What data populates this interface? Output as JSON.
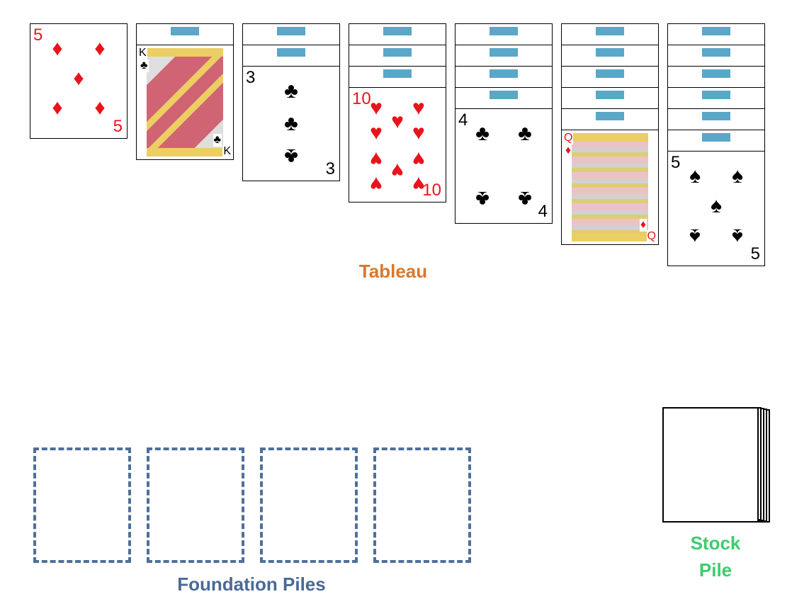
{
  "labels": {
    "tableau": "Tableau",
    "foundation": "Foundation Piles",
    "stock_line1": "Stock",
    "stock_line2": "Pile"
  },
  "colors": {
    "tableau_label": "#d9782d",
    "foundation_label": "#4a6a94",
    "stock_label": "#3dcc6e",
    "red_suit": "#e8141c",
    "foundation_border": "#4f6f9a"
  },
  "tableau": [
    {
      "face_down": 0,
      "top": {
        "rank": "5",
        "suit": "diamonds",
        "symbol": "♦",
        "color": "red"
      }
    },
    {
      "face_down": 1,
      "top": {
        "rank": "K",
        "suit": "clubs",
        "symbol": "♣",
        "color": "black"
      }
    },
    {
      "face_down": 2,
      "top": {
        "rank": "3",
        "suit": "clubs",
        "symbol": "♣",
        "color": "black"
      }
    },
    {
      "face_down": 3,
      "top": {
        "rank": "10",
        "suit": "hearts",
        "symbol": "♥",
        "color": "red"
      }
    },
    {
      "face_down": 4,
      "top": {
        "rank": "4",
        "suit": "clubs",
        "symbol": "♣",
        "color": "black"
      }
    },
    {
      "face_down": 5,
      "top": {
        "rank": "Q",
        "suit": "diamonds",
        "symbol": "♦",
        "color": "red"
      }
    },
    {
      "face_down": 6,
      "top": {
        "rank": "5",
        "suit": "spades",
        "symbol": "♠",
        "color": "black"
      }
    }
  ],
  "foundation_piles": 4,
  "stock_pile": {
    "face_down": true
  }
}
